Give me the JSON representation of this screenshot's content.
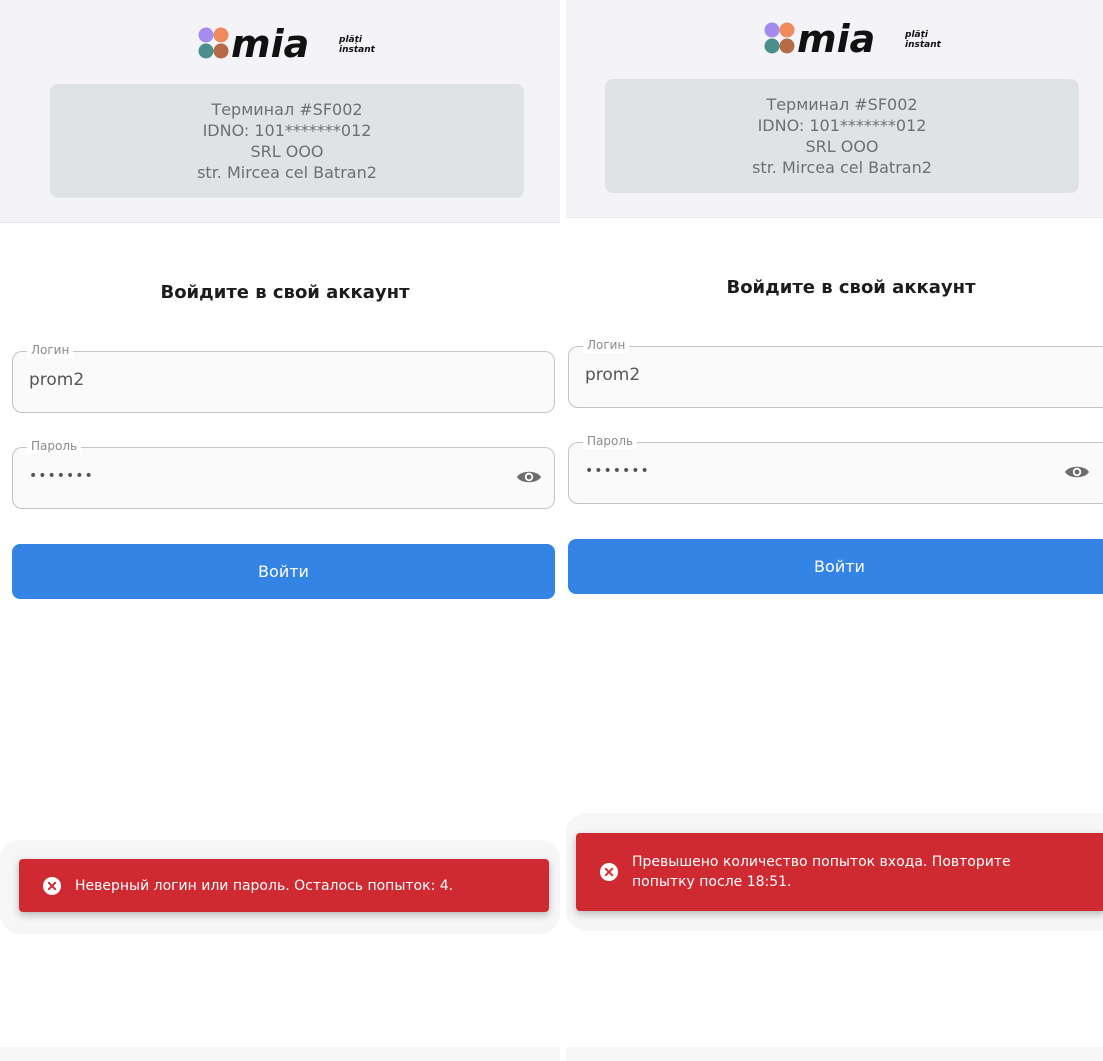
{
  "colors": {
    "accent_blue": "#3384e4",
    "error_red": "#cf2a31",
    "header_bg": "#f4f4f8",
    "card_bg": "#dfe3e6",
    "logo_dots": [
      "#a48bf0",
      "#f08a5d",
      "#4a8f8c",
      "#b46a45"
    ]
  },
  "brand": {
    "name": "mia",
    "tagline_line1": "plăți",
    "tagline_line2": "instant"
  },
  "terminal": {
    "line1": "Терминал #SF002",
    "line2": "IDNO: 101*******012",
    "line3": "SRL OOO",
    "line4": "str. Mircea cel Batran2"
  },
  "login_form": {
    "title": "Войдите в свой аккаунт",
    "login_label": "Логин",
    "login_value": "prom2",
    "password_label": "Пароль",
    "password_value": "•••••••",
    "submit_label": "Войти",
    "eye_icon": "eye-icon"
  },
  "screens": [
    {
      "toast_message": "Неверный логин или пароль. Осталось попыток: 4."
    },
    {
      "toast_message": "Превышено количество попыток входа. Повторите попытку после 18:51."
    }
  ]
}
